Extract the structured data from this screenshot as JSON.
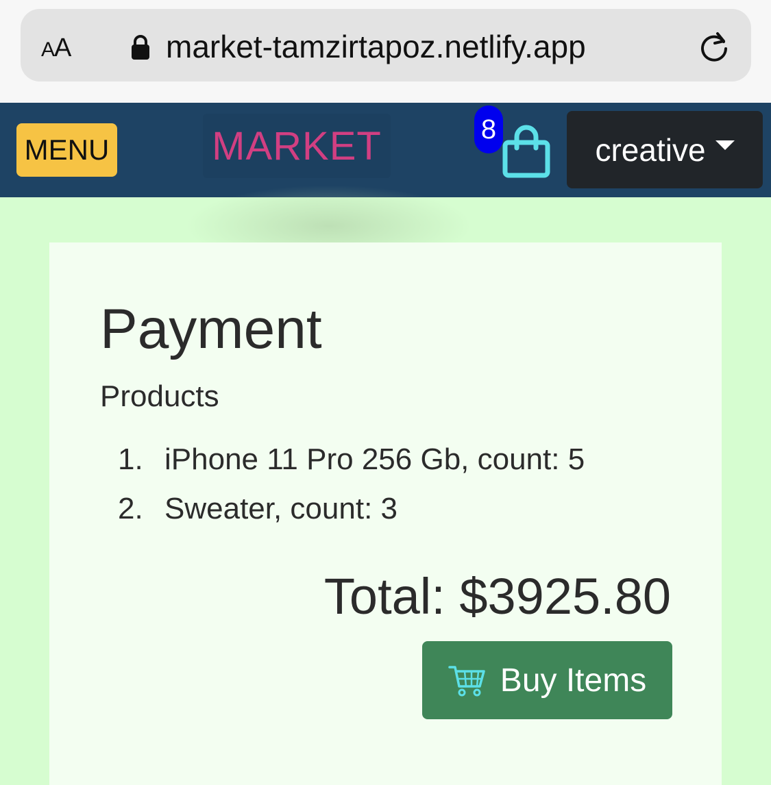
{
  "browser": {
    "text_size_small": "A",
    "text_size_large": "A",
    "url": "market-tamzirtapoz.netlify.app"
  },
  "navbar": {
    "menu_label": "MENU",
    "brand": "MARKET",
    "cart_count": "8",
    "user_label": "creative"
  },
  "payment": {
    "title": "Payment",
    "products_heading": "Products",
    "items": [
      {
        "num": "1.",
        "text": "iPhone 11 Pro 256 Gb, count: 5"
      },
      {
        "num": "2.",
        "text": "Sweater, count: 3"
      }
    ],
    "total": "Total: $3925.80",
    "buy_label": "Buy Items"
  },
  "colors": {
    "page_bg": "#d6fdd0",
    "navbar_bg": "#1e4364",
    "menu_bg": "#f6c344",
    "brand_text": "#d13f82",
    "badge_bg": "#0000ee",
    "bag_icon": "#5ce0e8",
    "dropdown_bg": "#212529",
    "buy_bg": "#3f8658"
  }
}
